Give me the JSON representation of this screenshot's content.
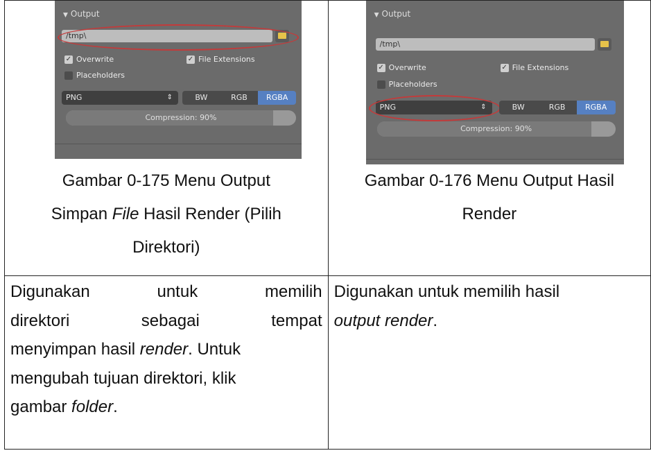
{
  "figure1": {
    "panel": {
      "header": "Output",
      "path": "/tmp\\",
      "overwrite": "Overwrite",
      "file_extensions": "File Extensions",
      "placeholders": "Placeholders",
      "format": "PNG",
      "color_modes": [
        "BW",
        "RGB",
        "RGBA"
      ],
      "selected_mode": "RGBA",
      "compression": "Compression: 90%",
      "compression_value": 0.9
    },
    "caption_line1": "Gambar 0-175 Menu Output",
    "caption_line2_a": "Simpan ",
    "caption_line2_italic": "File",
    "caption_line2_b": " Hasil Render (Pilih",
    "caption_line3": "Direktori)"
  },
  "figure2": {
    "panel": {
      "header": "Output",
      "path": "/tmp\\",
      "overwrite": "Overwrite",
      "file_extensions": "File Extensions",
      "placeholders": "Placeholders",
      "format": "PNG",
      "color_modes": [
        "BW",
        "RGB",
        "RGBA"
      ],
      "selected_mode": "RGBA",
      "compression": "Compression: 90%",
      "compression_value": 0.9
    },
    "caption_line1": "Gambar 0-176 Menu Output Hasil",
    "caption_line2": "Render"
  },
  "description1": {
    "l1a": "Digunakan",
    "l1b": "untuk",
    "l1c": "memilih",
    "l2a": "direktori",
    "l2b": "sebagai",
    "l2c": "tempat",
    "l3a": "menyimpan hasil ",
    "l3i": "render",
    "l3b": ". Untuk",
    "l4": "mengubah tujuan direktori, klik",
    "l5a": "gambar ",
    "l5i": "folder",
    "l5b": "."
  },
  "description2": {
    "l1": "Digunakan untuk memilih hasil",
    "l2i": "output render",
    "l2b": "."
  }
}
